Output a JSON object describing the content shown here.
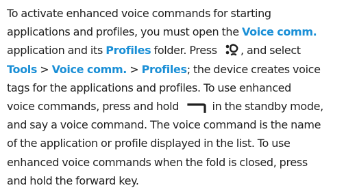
{
  "paragraph": {
    "line1": "To activate enhanced voice commands for starting",
    "line2_a": "applications and profiles, you must open the ",
    "kw_voice_comm_1": "Voice comm.",
    "line3_a": "application and its ",
    "kw_profiles_1": "Profiles",
    "line3_b": " folder. Press ",
    "line3_c": ", and select",
    "kw_tools": "Tools",
    "sep_1": " > ",
    "kw_voice_comm_2": "Voice comm.",
    "sep_2": " > ",
    "kw_profiles_2": "Profiles",
    "line4_b": "; the device creates voice",
    "line5": "tags for the applications and profiles. To use enhanced",
    "line6_a": "voice commands, press and hold ",
    "line6_b": " in the standby mode,",
    "line7": "and say a voice command. The voice command is the name",
    "line8": "of the application or profile displayed in the list. To use",
    "line9": "enhanced voice commands when the fold is closed, press",
    "line10": "and hold the forward key."
  },
  "icons": {
    "menu_key": "menu-key-icon",
    "send_key": "send-key-icon"
  },
  "colors": {
    "text": "#1f1f1f",
    "keyword": "#1a8fd6"
  }
}
